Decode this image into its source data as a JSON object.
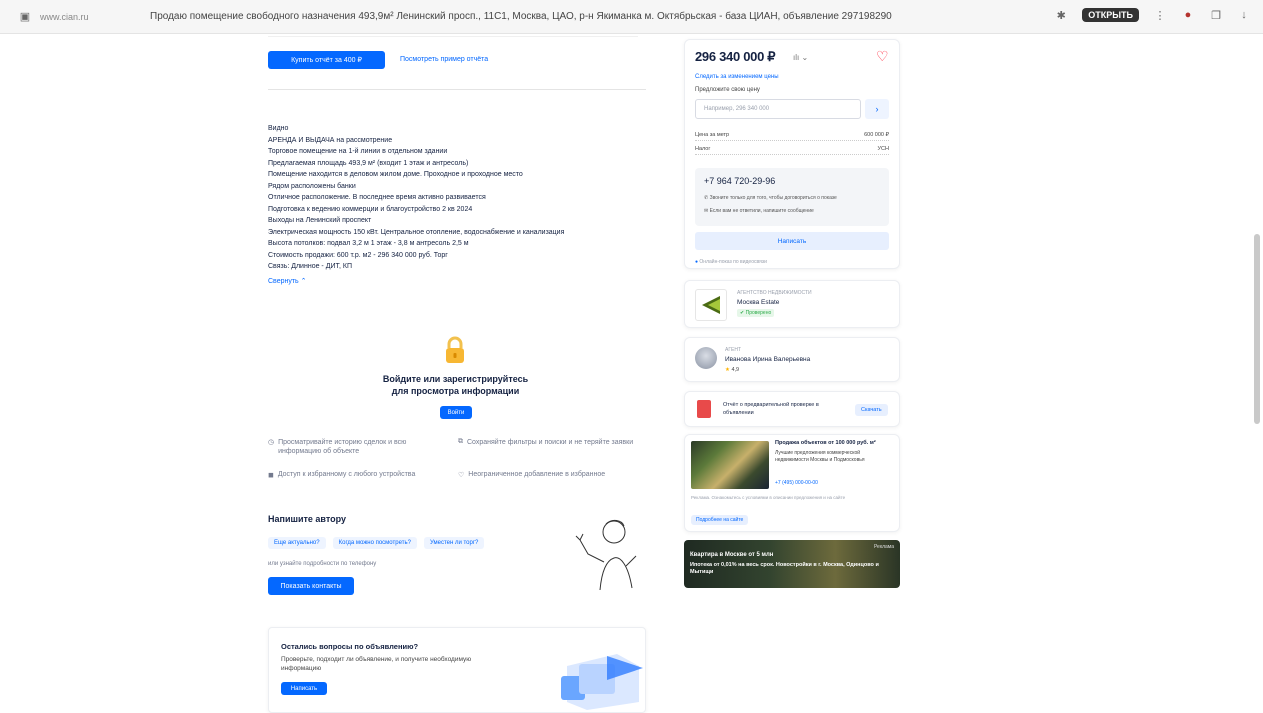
{
  "browser": {
    "url": "www.cian.ru",
    "title": "Продаю помещение свободного назначения 493,9м² Ленинский просп., 11С1, Москва, ЦАО, р-н Якиманка м. Октябрьская - база ЦИАН, объявление 297198290",
    "badge": "ОТКРЫТЬ"
  },
  "left": {
    "primary_btn": "Купить отчёт за 400 ₽",
    "example_link": "Посмотреть пример отчёта",
    "description": [
      "Видно",
      "АРЕНДА И ВЫДАЧА на рассмотрение",
      "Торговое помещение на 1-й линии в отдельном здании",
      "Предлагаемая площадь 493,9 м² (входит 1 этаж и антресоль)",
      "Помещение находится в деловом жилом доме. Проходное и проходное место",
      "Рядом расположены банки",
      "Отличное расположение. В последнее время активно развивается",
      "Подготовка к ведению коммерции и благоустройство 2 кв 2024",
      "Выходы на Ленинский проспект",
      "Электрическая мощность 150 кВт. Центральное отопление, водоснабжение и канализация",
      "Высота потолков: подвал 3,2 м 1 этаж - 3,8 м антресоль 2,5 м",
      "Стоимость продажи: 600 т.р. м2 - 296 340 000 руб. Торг",
      "Связь: Длинное - ДИТ, КП"
    ],
    "expand_link": "Свернуть",
    "auth_title_1": "Войдите или зарегистрируйтесь",
    "auth_title_2": "для просмотра информации",
    "auth_btn": "Войти",
    "features": [
      "Просматривайте историю сделок и всю информацию об объекте",
      "Сохраняйте фильтры и поиски и не теряйте заявки",
      "Доступ к избранному с любого устройства",
      "Неограниченное добавление в избранное"
    ],
    "author_title": "Напишите автору",
    "author_chips": [
      "Еще актуально?",
      "Когда можно посмотреть?",
      "Уместен ли торг?"
    ],
    "author_hint": "или узнайте подробности по телефону",
    "author_btn": "Показать контакты",
    "bottom_title": "Остались вопросы по объявлению?",
    "bottom_text": "Проверьте, подходит ли объявление, и получите необходимую информацию",
    "bottom_btn": "Написать"
  },
  "right": {
    "price": "296 340 000 ₽",
    "price_link": "Следить за изменением цены",
    "offer_label": "Предложите свою цену",
    "offer_placeholder": "Например, 296 340 000",
    "row1_label": "Цена за метр",
    "row1_value": "600 000 ₽",
    "row2_label": "Налог",
    "row2_value": "УСН",
    "phone": "+7 964 720-29-96",
    "phone_note1": "Звоните только для того, чтобы договориться о показе",
    "phone_note2": "Если вам не ответили, напишите сообщение",
    "write_btn": "Написать",
    "online_note": "Онлайн-показ по видеосвязи",
    "agency_label": "АГЕНТСТВО НЕДВИЖИМОСТИ",
    "agency_name": "Москва Estate",
    "agency_badge": "Проверено",
    "agent_label": "АГЕНТ",
    "agent_name": "Иванова Ирина Валерьевна",
    "agent_rating": "4,9",
    "report_text": "Отчёт о предварительной проверке в объявлении",
    "report_btn": "Скачать",
    "ad_title": "Продажа объектов от 100 000 руб. м²",
    "ad_text": "Лучшие предложения коммерческой недвижимости Москвы и Подмосковья",
    "ad_phone": "+7 (495) 000-00-00",
    "ad_note": "Реклама. Ознакомьтесь с условиями в описании предложения и на сайте",
    "ad_btn": "Подробнее на сайте",
    "banner_label": "Реклама",
    "banner_title": "Квартира в Москве от 5 млн",
    "banner_text": "Ипотека от 0,01% на весь срок. Новостройки в г. Москва, Одинцово и Мытищи"
  },
  "colors": {
    "accent": "#0468ff",
    "heart": "#ff1f34",
    "text": "#152242"
  }
}
